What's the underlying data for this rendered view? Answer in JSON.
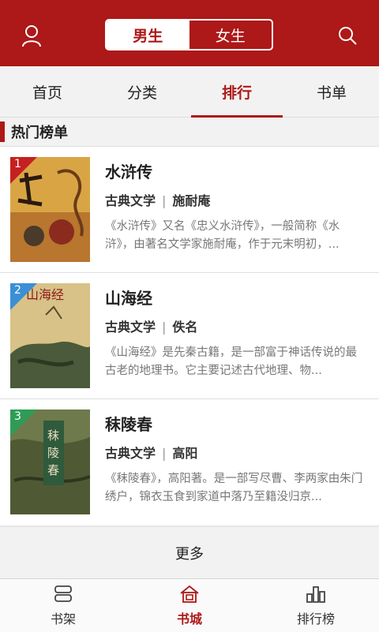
{
  "header": {
    "gender_tabs": [
      "男生",
      "女生"
    ],
    "active_gender": "男生"
  },
  "tabs": [
    "首页",
    "分类",
    "排行",
    "书单"
  ],
  "active_tab": "排行",
  "section_title": "热门榜单",
  "books": [
    {
      "rank": "1",
      "title": "水浒传",
      "category": "古典文学",
      "author": "施耐庵",
      "desc": "《水浒传》又名《忠义水浒传》，一般简称《水浒》，由著名文学家施耐庵，作于元末明初，...",
      "rank_color": "#c62020"
    },
    {
      "rank": "2",
      "title": "山海经",
      "category": "古典文学",
      "author": "佚名",
      "desc": "《山海经》是先秦古籍，是一部富于神话传说的最古老的地理书。它主要记述古代地理、物...",
      "rank_color": "#3b8fd6"
    },
    {
      "rank": "3",
      "title": "秣陵春",
      "category": "古典文学",
      "author": "高阳",
      "desc": "《秣陵春》，高阳著。是一部写尽曹、李两家由朱门绣户，锦衣玉食到家道中落乃至籍没归京...",
      "rank_color": "#2e9c56"
    }
  ],
  "more_label": "更多",
  "bottom_nav": [
    {
      "label": "书架",
      "icon": "bookshelf-icon"
    },
    {
      "label": "书城",
      "icon": "bookstore-icon"
    },
    {
      "label": "排行榜",
      "icon": "ranking-icon"
    }
  ],
  "active_bottom": "书城",
  "colors": {
    "brand": "#ad1818"
  }
}
